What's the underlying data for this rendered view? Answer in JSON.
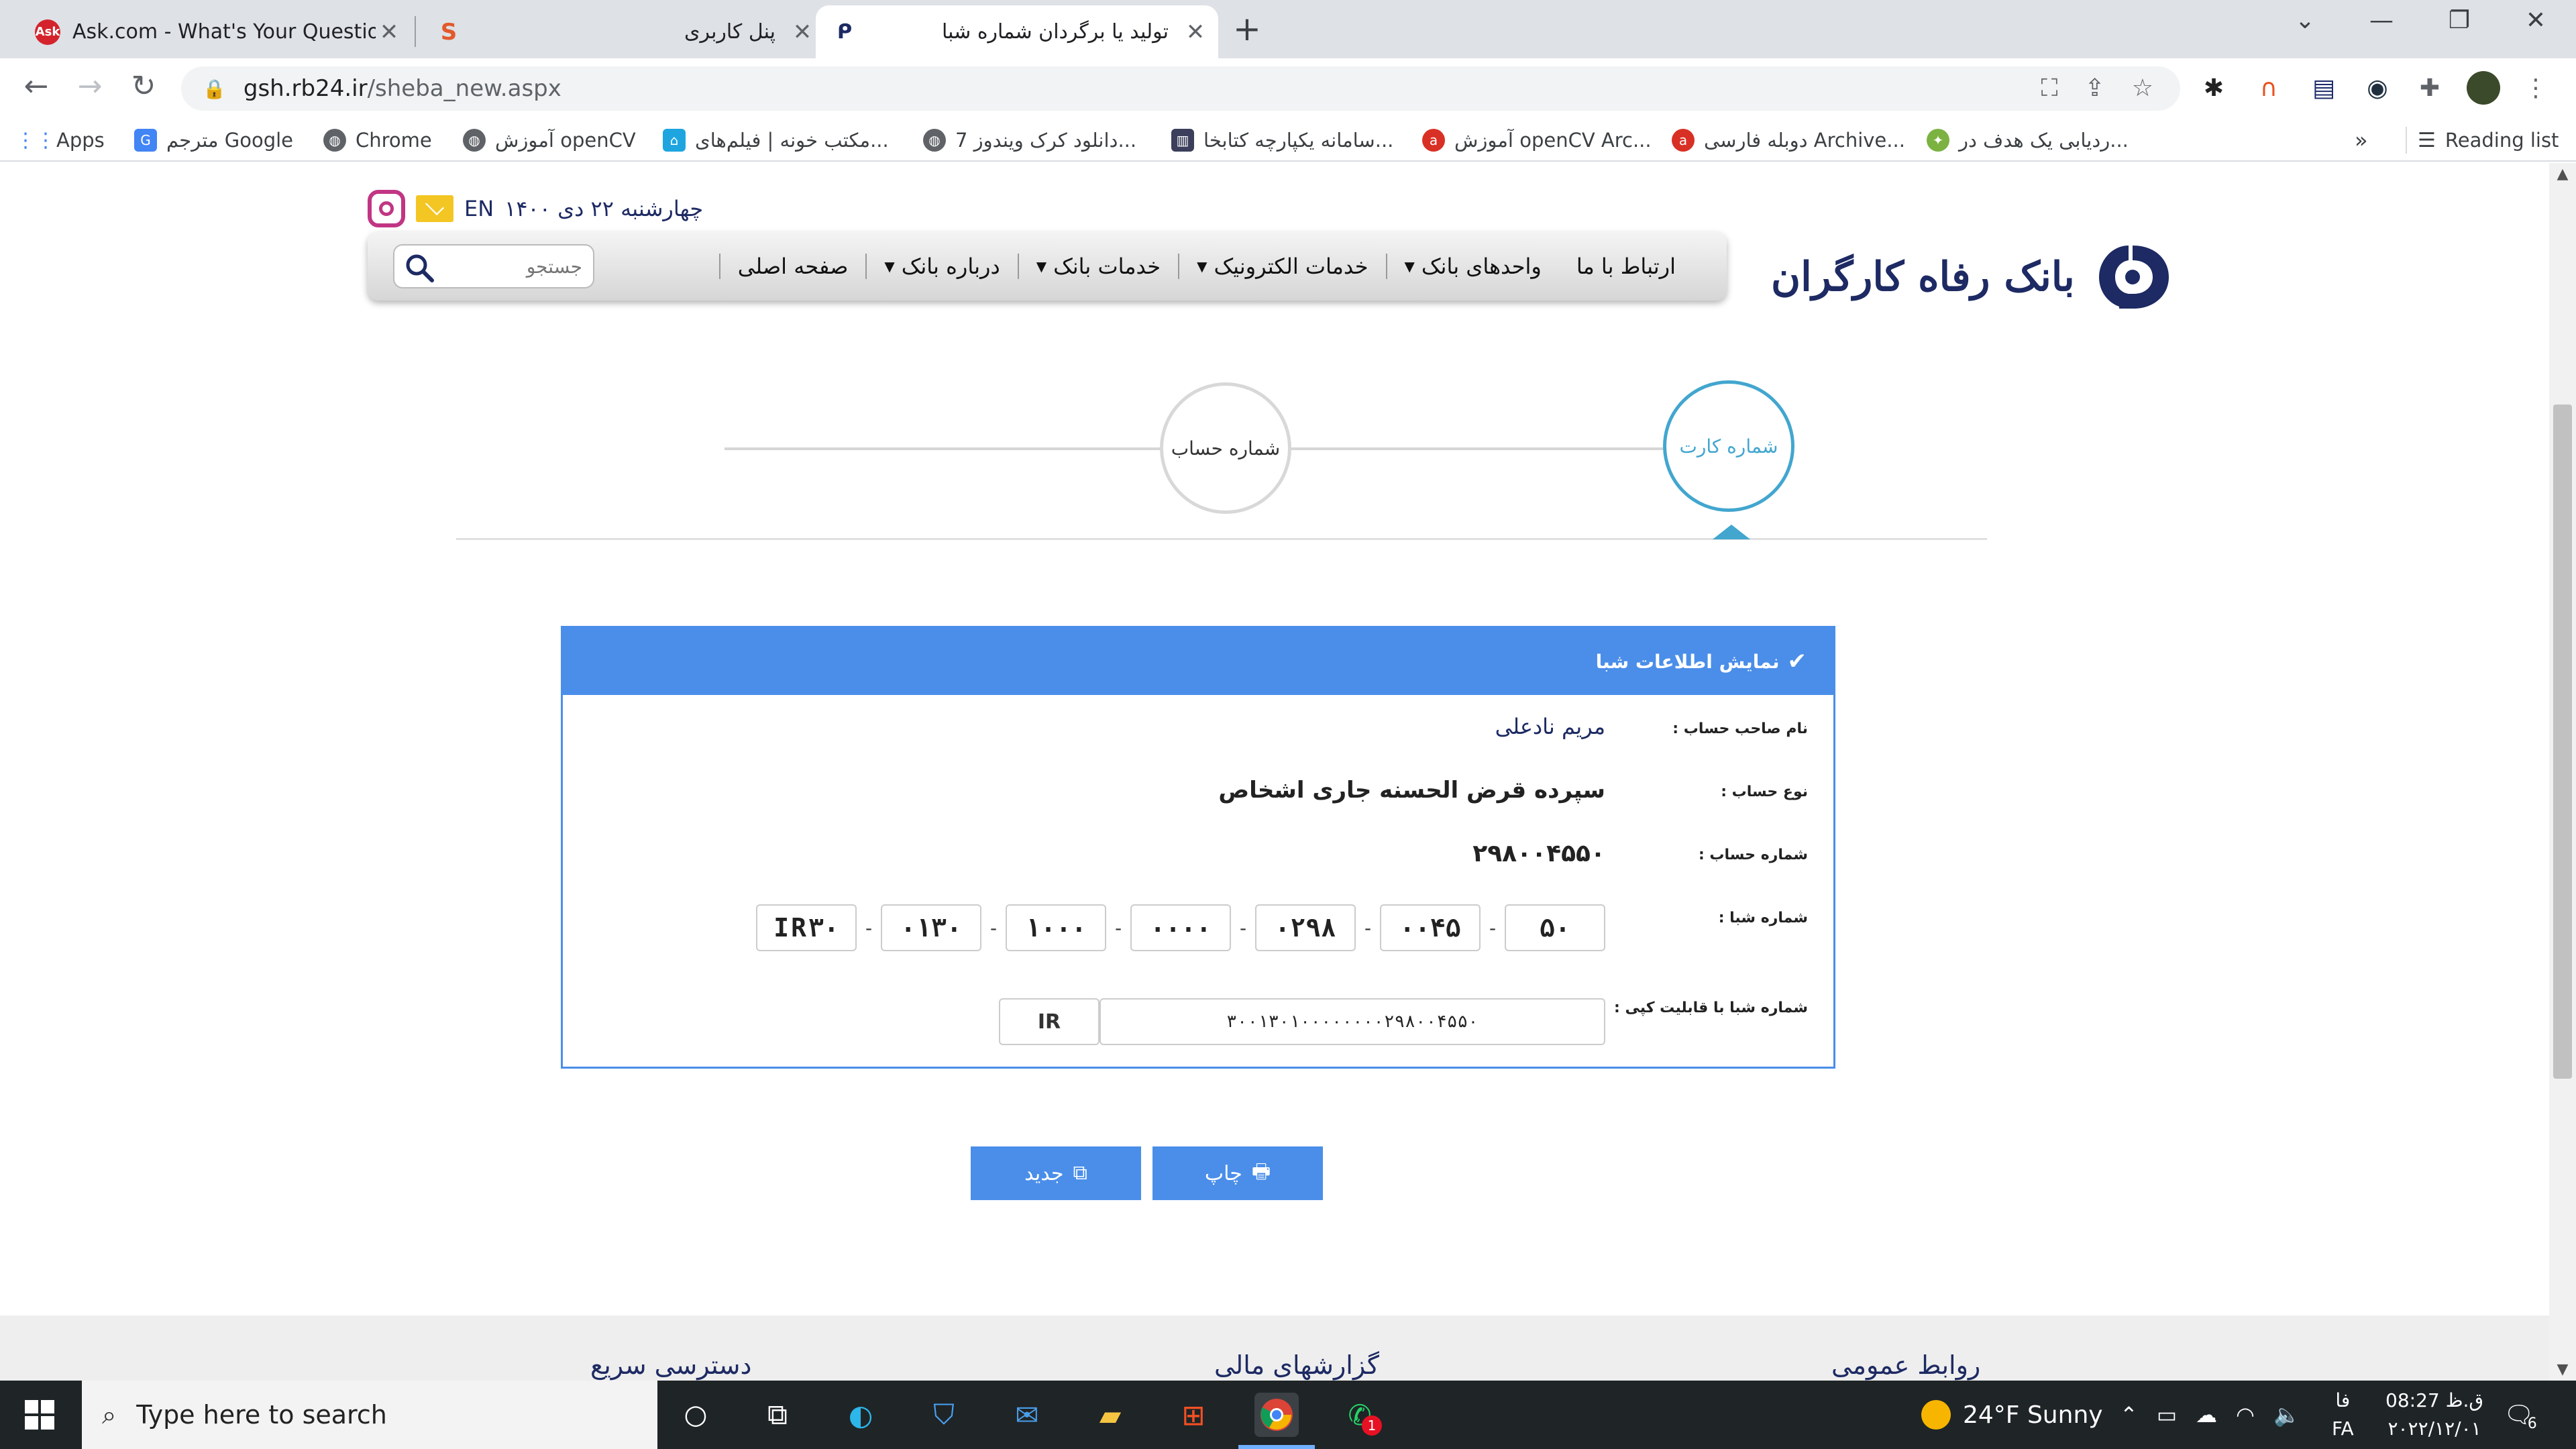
{
  "browser": {
    "tabs": [
      {
        "title": "Ask.com - What's Your Question?",
        "icon": "ask-icon",
        "active": false
      },
      {
        "title": "پنل کاربری",
        "icon": "rb24-icon",
        "active": false
      },
      {
        "title": "تولید یا برگردان شماره شبا",
        "icon": "refah-icon",
        "active": true
      }
    ],
    "new_tab": "+",
    "url_host": "gsh.rb24.ir",
    "url_path": "/sheba_new.aspx",
    "bookmarks": [
      {
        "label": "Apps",
        "icon": "apps-grid-icon"
      },
      {
        "label": "مترجم Google",
        "icon": "google-translate-icon"
      },
      {
        "label": "Chrome",
        "icon": "chrome-globe-icon"
      },
      {
        "label": "آموزش openCV",
        "icon": "globe-icon"
      },
      {
        "label": "مکتب خونه | فیلم‌های...",
        "icon": "maktabkhooneh-icon"
      },
      {
        "label": "دانلود کرک ویندوز 7...",
        "icon": "globe-icon"
      },
      {
        "label": "سامانه یکپارچه کتابخا...",
        "icon": "library-icon"
      },
      {
        "label": "آموزش openCV Arc...",
        "icon": "red-logo-icon"
      },
      {
        "label": "دوبله فارسی Archive...",
        "icon": "red-logo-icon"
      },
      {
        "label": "ردیابی یک هدف در...",
        "icon": "green-logo-icon"
      }
    ],
    "bookmarks_more": "»",
    "reading_list": "Reading list"
  },
  "site": {
    "date_line": "چهارشنبه ۲۲ دی ۱۴۰۰",
    "lang": "EN",
    "logo_text": "بانک رفاه کارگران",
    "menu": [
      {
        "label": "صفحه اصلی",
        "dropdown": false
      },
      {
        "label": "درباره بانک",
        "dropdown": true
      },
      {
        "label": "خدمات بانک",
        "dropdown": true
      },
      {
        "label": "خدمات الکترونیک",
        "dropdown": true
      },
      {
        "label": "واحدهای بانک",
        "dropdown": true
      },
      {
        "label": "ارتباط با ما",
        "dropdown": false
      }
    ],
    "search_placeholder": "جستجو",
    "steps": [
      {
        "label": "شماره کارت",
        "active": true
      },
      {
        "label": "شماره حساب",
        "active": false
      }
    ],
    "panel": {
      "title": "نمایش اطلاعات شبا",
      "owner_label": "نام صاحب حساب :",
      "owner_value": "مریم نادعلی",
      "type_label": "نوع حساب :",
      "type_value": "سپرده قرض الحسنه جاری اشخاص",
      "account_label": "شماره حساب :",
      "account_value": "۲۹۸۰۰۴۵۵۰",
      "iban_label": "شماره شبا :",
      "iban_parts": [
        "IR۳۰",
        "۰۱۳۰",
        "۱۰۰۰",
        "۰۰۰۰",
        "۰۲۹۸",
        "۰۰۴۵",
        "۵۰"
      ],
      "iban_dash": "-",
      "copy_label": "شماره شبا با قابلیت کپی :",
      "copy_prefix": "IR",
      "copy_value": "۳۰۰۱۳۰۱۰۰۰۰۰۰۰۰۲۹۸۰۰۴۵۵۰"
    },
    "buttons": {
      "print": "چاپ",
      "new": "جدید"
    },
    "footer": [
      "دسترسی سریع",
      "گزارشهای مالی",
      "روابط عمومی"
    ]
  },
  "taskbar": {
    "search_text": "Type here to search",
    "weather": "24°F  Sunny",
    "lang_top": "فا",
    "lang_bottom": "FA",
    "time": "08:27 ق.ظ",
    "date": "۲۰۲۲/۱۲/۰۱",
    "notifications": "6",
    "whatsapp_badge": "1"
  },
  "colors": {
    "accent": "#4a8ee9",
    "step_active": "#42a6cf",
    "brand_navy": "#1d2a63"
  }
}
